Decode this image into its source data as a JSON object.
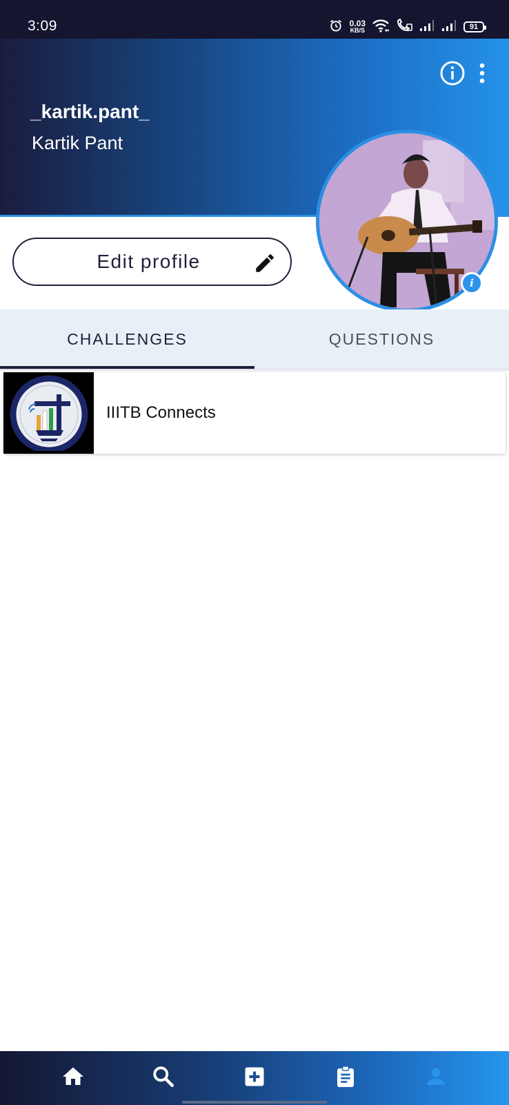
{
  "status_bar": {
    "time": "3:09",
    "net_speed_value": "0.03",
    "net_speed_unit": "KB/S",
    "battery": "91",
    "icons": [
      "alarm-icon",
      "wifi-icon",
      "volte-call-icon",
      "signal-icon",
      "signal-icon"
    ]
  },
  "header": {
    "username": "_kartik.pant_",
    "full_name": "Kartik Pant",
    "actions": [
      "info-icon",
      "more-vertical-icon"
    ]
  },
  "profile": {
    "edit_label": "Edit profile",
    "edit_icon": "pencil-icon",
    "avatar_badge": "i"
  },
  "tabs": [
    {
      "label": "CHALLENGES",
      "active": true
    },
    {
      "label": "QUESTIONS",
      "active": false
    }
  ],
  "challenges": [
    {
      "title": "IIITB Connects"
    }
  ],
  "bottom_nav": [
    {
      "icon": "home-icon",
      "active": false
    },
    {
      "icon": "search-icon",
      "active": false
    },
    {
      "icon": "add-box-icon",
      "active": false
    },
    {
      "icon": "assignment-icon",
      "active": false
    },
    {
      "icon": "person-icon",
      "active": true
    }
  ],
  "colors": {
    "accent": "#2a8ee0",
    "dark_navy": "#1e1f3b",
    "tab_bg": "#e8f0f7",
    "active_nav": "#2a94ec"
  }
}
